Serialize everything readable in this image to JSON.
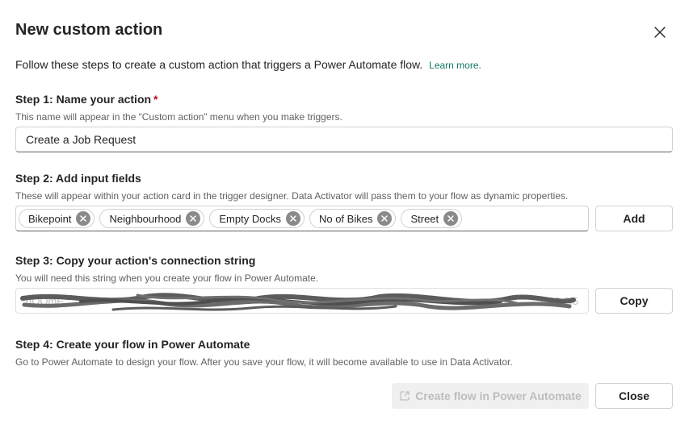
{
  "dialog": {
    "title": "New custom action",
    "intro": "Follow these steps to create a custom action that triggers a Power Automate flow.",
    "learn_more": "Learn more."
  },
  "step1": {
    "title": "Step 1: Name your action",
    "required_mark": "*",
    "description": "This name will appear in the “Custom action” menu when you make triggers.",
    "value": "Create a Job Request"
  },
  "step2": {
    "title": "Step 2: Add input fields",
    "description": "These will appear within your action card in the trigger designer. Data Activator will pass them to your flow as dynamic properties.",
    "tags": [
      "Bikepoint",
      "Neighbourhood",
      "Empty Docks",
      "No of Bikes",
      "Street"
    ],
    "add_label": "Add"
  },
  "step3": {
    "title": "Step 3: Copy your action's connection string",
    "description": "You will need this string when you create your flow in Power Automate.",
    "connection_string": "gOOmE",
    "connection_string_tail": "5612-2f5",
    "copy_label": "Copy"
  },
  "step4": {
    "title": "Step 4: Create your flow in Power Automate",
    "description": "Go to Power Automate to design your flow. After you save your flow, it will become available to use in Data Activator."
  },
  "footer": {
    "create_flow_label": "Create flow in Power Automate",
    "close_label": "Close"
  },
  "icons": {
    "close": "close-icon",
    "tag_dismiss": "dismiss-circle-icon",
    "open_external": "open-external-icon"
  },
  "colors": {
    "link": "#117865",
    "required": "#c50f1f",
    "redaction": "#5c5c5c"
  }
}
